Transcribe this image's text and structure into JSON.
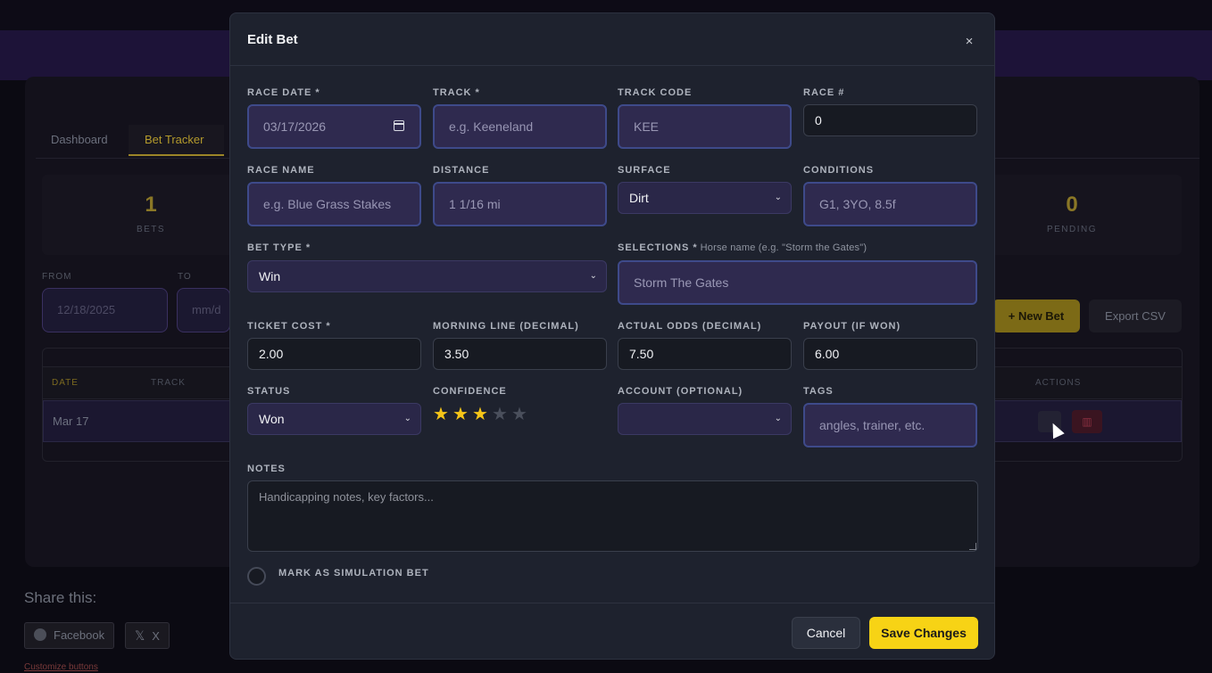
{
  "background": {
    "tabs": [
      "Dashboard",
      "Bet Tracker"
    ],
    "stats": [
      {
        "value": "1",
        "label": "BETS"
      },
      {
        "value": "0",
        "label": "PENDING"
      }
    ],
    "filters": {
      "from_label": "FROM",
      "to_label": "TO",
      "from_value": "12/18/2025",
      "to_placeholder": "mm/d"
    },
    "new_bet_label": "+ New Bet",
    "export_label": "Export CSV",
    "table": {
      "headers": [
        "DATE",
        "TRACK",
        "ACTIONS"
      ],
      "rows": [
        {
          "date": "Mar 17"
        }
      ]
    },
    "share": {
      "title": "Share this:",
      "facebook": "Facebook",
      "x": "X",
      "customize": "Customize buttons"
    }
  },
  "modal": {
    "title": "Edit Bet",
    "close_symbol": "×",
    "fields": {
      "race_date": {
        "label": "RACE DATE *",
        "value": "03/17/2026"
      },
      "track": {
        "label": "TRACK *",
        "placeholder": "e.g. Keeneland"
      },
      "track_code": {
        "label": "TRACK CODE",
        "value": "KEE"
      },
      "race_number": {
        "label": "RACE #",
        "value": "0"
      },
      "race_name": {
        "label": "RACE NAME",
        "placeholder": "e.g. Blue Grass Stakes"
      },
      "distance": {
        "label": "DISTANCE",
        "value": "1 1/16 mi"
      },
      "surface": {
        "label": "SURFACE",
        "value": "Dirt"
      },
      "conditions": {
        "label": "CONDITIONS",
        "value": "G1, 3YO, 8.5f"
      },
      "bet_type": {
        "label": "BET TYPE *",
        "value": "Win"
      },
      "selections": {
        "label": "SELECTIONS *",
        "hint": "Horse name (e.g. \"Storm the Gates\")",
        "value": "Storm The Gates"
      },
      "ticket_cost": {
        "label": "TICKET COST *",
        "value": "2.00"
      },
      "morning_line": {
        "label": "MORNING LINE (DECIMAL)",
        "value": "3.50"
      },
      "actual_odds": {
        "label": "ACTUAL ODDS (DECIMAL)",
        "value": "7.50"
      },
      "payout": {
        "label": "PAYOUT (IF WON)",
        "value": "6.00"
      },
      "status": {
        "label": "STATUS",
        "value": "Won"
      },
      "confidence": {
        "label": "CONFIDENCE",
        "rating": 3,
        "max": 5
      },
      "account": {
        "label": "ACCOUNT (OPTIONAL)",
        "value": ""
      },
      "tags": {
        "label": "TAGS",
        "placeholder": "angles, trainer, etc."
      },
      "notes": {
        "label": "NOTES",
        "placeholder": "Handicapping notes, key factors..."
      },
      "simulation": {
        "label": "MARK AS SIMULATION BET",
        "checked": false
      }
    },
    "buttons": {
      "cancel": "Cancel",
      "save": "Save Changes"
    }
  }
}
